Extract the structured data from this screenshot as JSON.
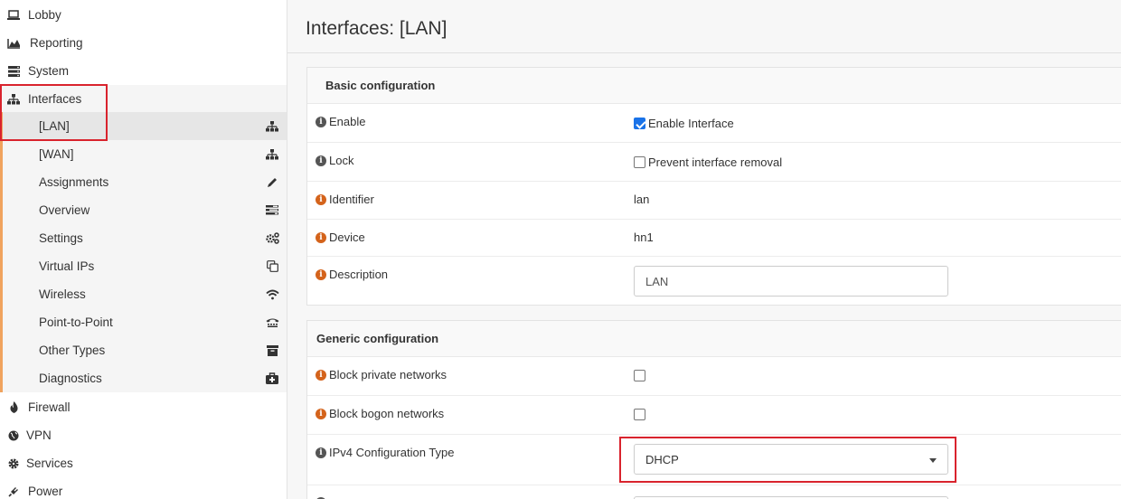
{
  "sidebar": {
    "top_items": [
      {
        "label": "Lobby",
        "icon": "laptop-icon"
      },
      {
        "label": "Reporting",
        "icon": "area-chart-icon"
      },
      {
        "label": "System",
        "icon": "server-icon"
      },
      {
        "label": "Interfaces",
        "icon": "sitemap-icon"
      }
    ],
    "sub_items": [
      {
        "label": "[LAN]",
        "icon": "sitemap-icon"
      },
      {
        "label": "[WAN]",
        "icon": "sitemap-icon"
      },
      {
        "label": "Assignments",
        "icon": "pencil-icon"
      },
      {
        "label": "Overview",
        "icon": "tasks-icon"
      },
      {
        "label": "Settings",
        "icon": "cogs-icon"
      },
      {
        "label": "Virtual IPs",
        "icon": "copy-icon"
      },
      {
        "label": "Wireless",
        "icon": "wifi-icon"
      },
      {
        "label": "Point-to-Point",
        "icon": "tty-icon"
      },
      {
        "label": "Other Types",
        "icon": "archive-icon"
      },
      {
        "label": "Diagnostics",
        "icon": "medkit-icon"
      }
    ],
    "bottom_items": [
      {
        "label": "Firewall",
        "icon": "fire-icon"
      },
      {
        "label": "VPN",
        "icon": "globe-icon"
      },
      {
        "label": "Services",
        "icon": "cog-icon"
      },
      {
        "label": "Power",
        "icon": "plug-icon"
      }
    ]
  },
  "page": {
    "title": "Interfaces: [LAN]"
  },
  "basic": {
    "heading": "Basic configuration",
    "enable_label": "Enable",
    "enable_checkbox_label": "Enable Interface",
    "lock_label": "Lock",
    "lock_checkbox_label": "Prevent interface removal",
    "identifier_label": "Identifier",
    "identifier_value": "lan",
    "device_label": "Device",
    "device_value": "hn1",
    "description_label": "Description",
    "description_value": "LAN"
  },
  "generic": {
    "heading": "Generic configuration",
    "block_private_label": "Block private networks",
    "block_bogon_label": "Block bogon networks",
    "ipv4_type_label": "IPv4 Configuration Type",
    "ipv4_type_value": "DHCP"
  },
  "colors": {
    "accent": "#f0a35e",
    "highlight": "#d9232d",
    "info_orange": "#d4631b"
  }
}
